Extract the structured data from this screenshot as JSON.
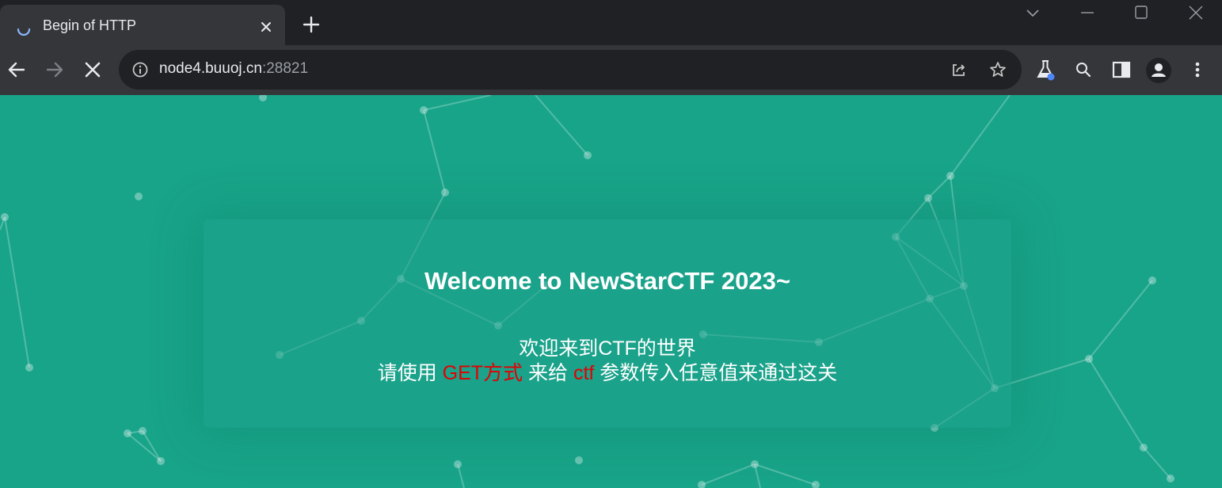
{
  "browser": {
    "tab": {
      "title": "Begin of HTTP"
    },
    "address_bar": {
      "host": "node4.buuoj.cn",
      "port": ":28821"
    }
  },
  "page": {
    "welcome": "Welcome to NewStarCTF 2023~",
    "line1": "欢迎来到CTF的世界",
    "line2": {
      "part1": "请使用 ",
      "method": "GET方式",
      "part2": " 来给 ",
      "param": "ctf",
      "part3": " 参数传入任意值来通过这关"
    }
  },
  "colors": {
    "page_background": "#18a489",
    "highlight": "#e30000",
    "chrome_dark": "#202124",
    "chrome_toolbar": "#35363a"
  },
  "icons": {
    "tab": [
      "loading-spinner-icon",
      "close-icon",
      "new-tab-plus-icon"
    ],
    "window": [
      "tab-search-chevron-icon",
      "minimize-icon",
      "maximize-icon",
      "window-close-icon"
    ],
    "toolbar": [
      "back-arrow-icon",
      "forward-arrow-icon",
      "stop-loading-icon",
      "site-info-icon",
      "share-icon",
      "bookmark-star-icon",
      "labs-flask-icon",
      "zoom-search-icon",
      "side-panel-icon",
      "profile-icon",
      "more-menu-icon"
    ]
  }
}
